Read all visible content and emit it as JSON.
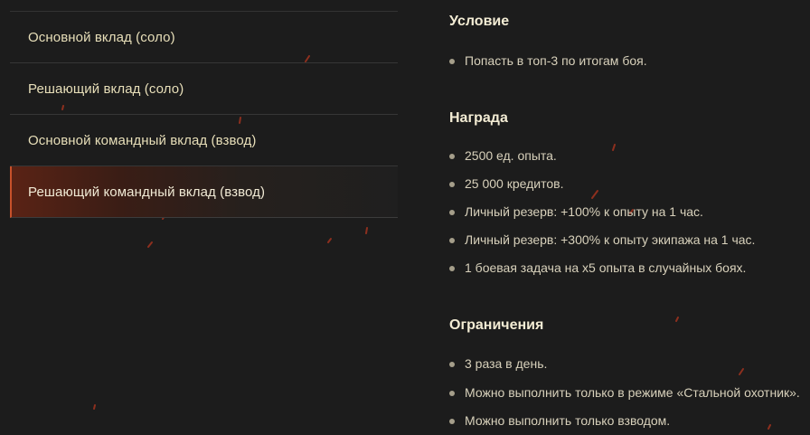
{
  "tabs": [
    {
      "label": "Основной вклад (соло)",
      "active": false
    },
    {
      "label": "Решающий вклад (соло)",
      "active": false
    },
    {
      "label": "Основной командный вклад (взвод)",
      "active": false
    },
    {
      "label": "Решающий командный вклад (взвод)",
      "active": true
    }
  ],
  "condition": {
    "title": "Условие",
    "items": [
      "Попасть в топ-3 по итогам боя."
    ]
  },
  "reward": {
    "title": "Награда",
    "items": [
      "2500 ед. опыта.",
      "25 000 кредитов.",
      "Личный резерв: +100% к опыту на 1 час.",
      "Личный резерв: +300% к опыту экипажа на 1 час.",
      "1 боевая задача на x5 опыта в случайных боях."
    ]
  },
  "restrictions": {
    "title": "Ограничения",
    "items": [
      "3 раза в день.",
      "Можно выполнить только в режиме «Стальной охотник».",
      "Можно выполнить только взводом."
    ]
  },
  "colors": {
    "background": "#1c1c1c",
    "accent": "#c8512a",
    "spark": "#b3361f"
  }
}
